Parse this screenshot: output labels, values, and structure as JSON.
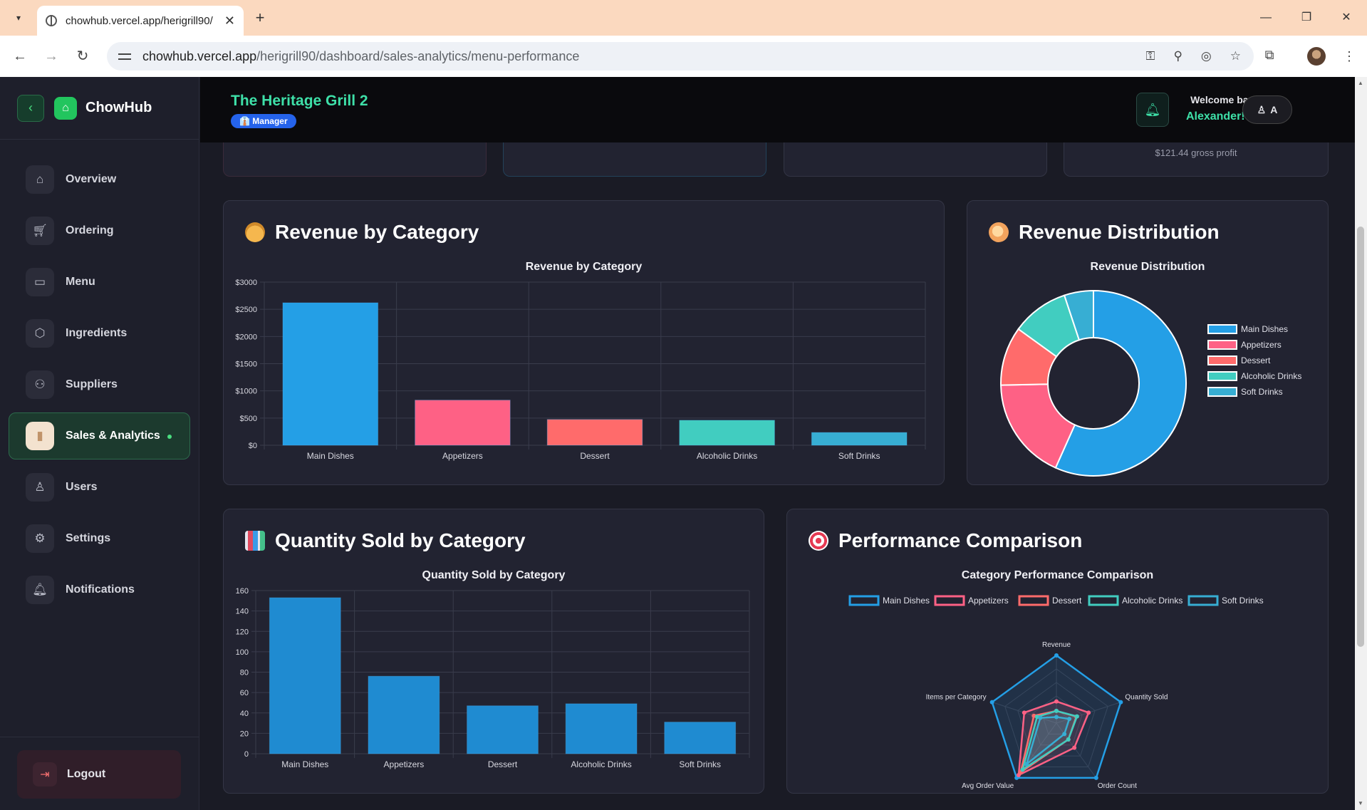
{
  "browser": {
    "tab_title": "chowhub.vercel.app/herigrill90/",
    "url_host": "chowhub.vercel.app",
    "url_path": "/herigrill90/dashboard/sales-analytics/menu-performance"
  },
  "sidebar": {
    "brand": "ChowHub",
    "items": [
      {
        "label": "Overview",
        "icon": "home-icon"
      },
      {
        "label": "Ordering",
        "icon": "cart-icon"
      },
      {
        "label": "Menu",
        "icon": "book-icon"
      },
      {
        "label": "Ingredients",
        "icon": "box-icon"
      },
      {
        "label": "Suppliers",
        "icon": "users-icon"
      },
      {
        "label": "Sales & Analytics",
        "icon": "bar-chart-icon",
        "active": true
      },
      {
        "label": "Users",
        "icon": "user-check-icon"
      },
      {
        "label": "Settings",
        "icon": "gear-icon"
      },
      {
        "label": "Notifications",
        "icon": "bell-icon"
      }
    ],
    "logout_label": "Logout"
  },
  "header": {
    "restaurant_name": "The Heritage Grill 2",
    "role_badge": "👔 Manager",
    "welcome_line1": "Welcome back,",
    "welcome_line2": "Alexander! 👋",
    "user_initial": "A"
  },
  "stat_cards": {
    "card4_sub": "$121.44 gross profit"
  },
  "panels": {
    "revenue_by_category": "Revenue by Category",
    "revenue_distribution": "Revenue Distribution",
    "quantity_sold": "Quantity Sold by Category",
    "performance_comparison": "Performance Comparison"
  },
  "colors": {
    "main_dishes": "#249fe6",
    "appetizers": "#fe6185",
    "dessert": "#ff6b6b",
    "alcoholic_drinks": "#41cdc0",
    "soft_drinks": "#37aed3",
    "quantity_bars": "#1f8bd1",
    "accent_green": "#3ee0a8"
  },
  "chart_data": [
    {
      "id": "revenue_bar",
      "type": "bar",
      "title": "Revenue by Category",
      "categories": [
        "Main Dishes",
        "Appetizers",
        "Dessert",
        "Alcoholic Drinks",
        "Soft Drinks"
      ],
      "values": [
        2620,
        830,
        475,
        460,
        235
      ],
      "y_ticks": [
        "$0",
        "$500",
        "$1000",
        "$1500",
        "$2000",
        "$2500",
        "$3000"
      ],
      "ylim": [
        0,
        3000
      ],
      "grid": true
    },
    {
      "id": "revenue_donut",
      "type": "pie",
      "title": "Revenue Distribution",
      "labels": [
        "Main Dishes",
        "Appetizers",
        "Dessert",
        "Alcoholic Drinks",
        "Soft Drinks"
      ],
      "values": [
        2620,
        830,
        475,
        460,
        235
      ],
      "legend": "right"
    },
    {
      "id": "quantity_bar",
      "type": "bar",
      "title": "Quantity Sold by Category",
      "categories": [
        "Main Dishes",
        "Appetizers",
        "Dessert",
        "Alcoholic Drinks",
        "Soft Drinks"
      ],
      "values": [
        153,
        76,
        47,
        49,
        31
      ],
      "y_ticks": [
        "0",
        "20",
        "40",
        "60",
        "80",
        "100",
        "120",
        "140",
        "160"
      ],
      "ylim": [
        0,
        160
      ],
      "grid": true
    },
    {
      "id": "performance_radar",
      "type": "radar",
      "title": "Category Performance Comparison",
      "axes": [
        "Revenue",
        "Quantity Sold",
        "Order Count",
        "Avg Order Value",
        "Items per Category"
      ],
      "series": [
        {
          "name": "Main Dishes",
          "values": [
            1.0,
            1.0,
            1.0,
            1.0,
            1.0
          ]
        },
        {
          "name": "Appetizers",
          "values": [
            0.32,
            0.5,
            0.45,
            0.95,
            0.5
          ]
        },
        {
          "name": "Dessert",
          "values": [
            0.18,
            0.31,
            0.3,
            0.9,
            0.35
          ]
        },
        {
          "name": "Alcoholic Drinks",
          "values": [
            0.18,
            0.32,
            0.3,
            0.85,
            0.3
          ]
        },
        {
          "name": "Soft Drinks",
          "values": [
            0.09,
            0.2,
            0.2,
            0.75,
            0.25
          ]
        }
      ],
      "legend": "top"
    }
  ]
}
